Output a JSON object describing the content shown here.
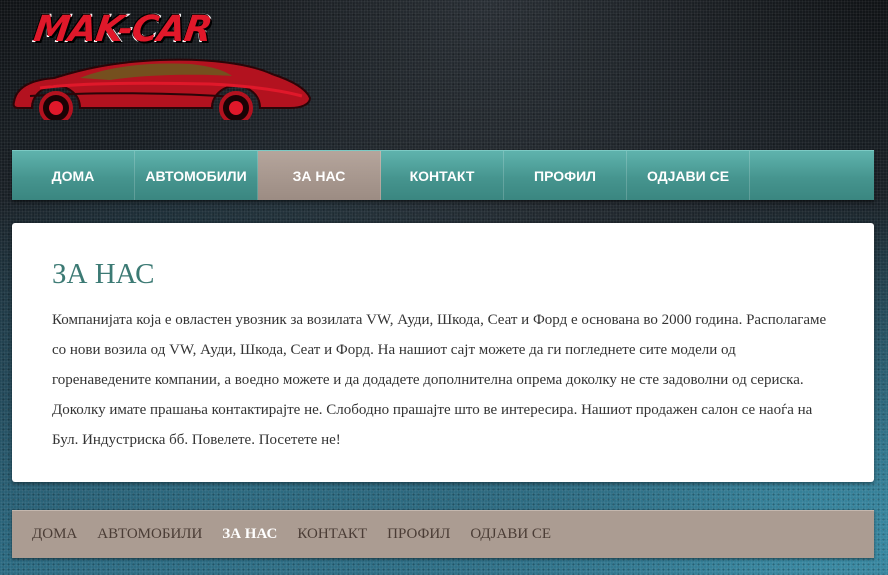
{
  "logo": {
    "text": "MAK-CAR",
    "icon": "car-silhouette-icon"
  },
  "topnav": {
    "items": [
      {
        "label": "ДОМА",
        "active": false
      },
      {
        "label": "АВТОМОБИЛИ",
        "active": false
      },
      {
        "label": "ЗА НАС",
        "active": true
      },
      {
        "label": "КОНТАКТ",
        "active": false
      },
      {
        "label": "ПРОФИЛ",
        "active": false
      },
      {
        "label": "ОДЈАВИ СЕ",
        "active": false
      }
    ]
  },
  "main": {
    "title": "ЗА НАС",
    "body": "Компанијата која е овластен увозник за возилата VW, Ауди, Шкода, Сеат и Форд е основана во 2000 година. Располагаме со нови возила од VW, Ауди, Шкода, Сеат и Форд. На нашиот сајт можете да ги погледнете сите модели од горенаведените компании, а воедно можете и да додадете дополнителна опрема доколку не сте задоволни од сериска. Доколку имате прашања контактирајте не. Слободно прашајте што ве интересира. Нашиот продажен салон се наоѓа на Бул. Индустриска бб. Повелете. Посетете не!"
  },
  "footer": {
    "links": [
      {
        "label": "ДОМА",
        "active": false
      },
      {
        "label": "АВТОМОБИЛИ",
        "active": false
      },
      {
        "label": "ЗА НАС",
        "active": true
      },
      {
        "label": "КОНТАКТ",
        "active": false
      },
      {
        "label": "ПРОФИЛ",
        "active": false
      },
      {
        "label": "ОДЈАВИ СЕ",
        "active": false
      }
    ]
  },
  "colors": {
    "nav_teal": "#46958f",
    "nav_active": "#a3938a",
    "title_teal": "#3c7a74",
    "footer_bg": "#ab9c92",
    "logo_red": "#e0182a"
  }
}
